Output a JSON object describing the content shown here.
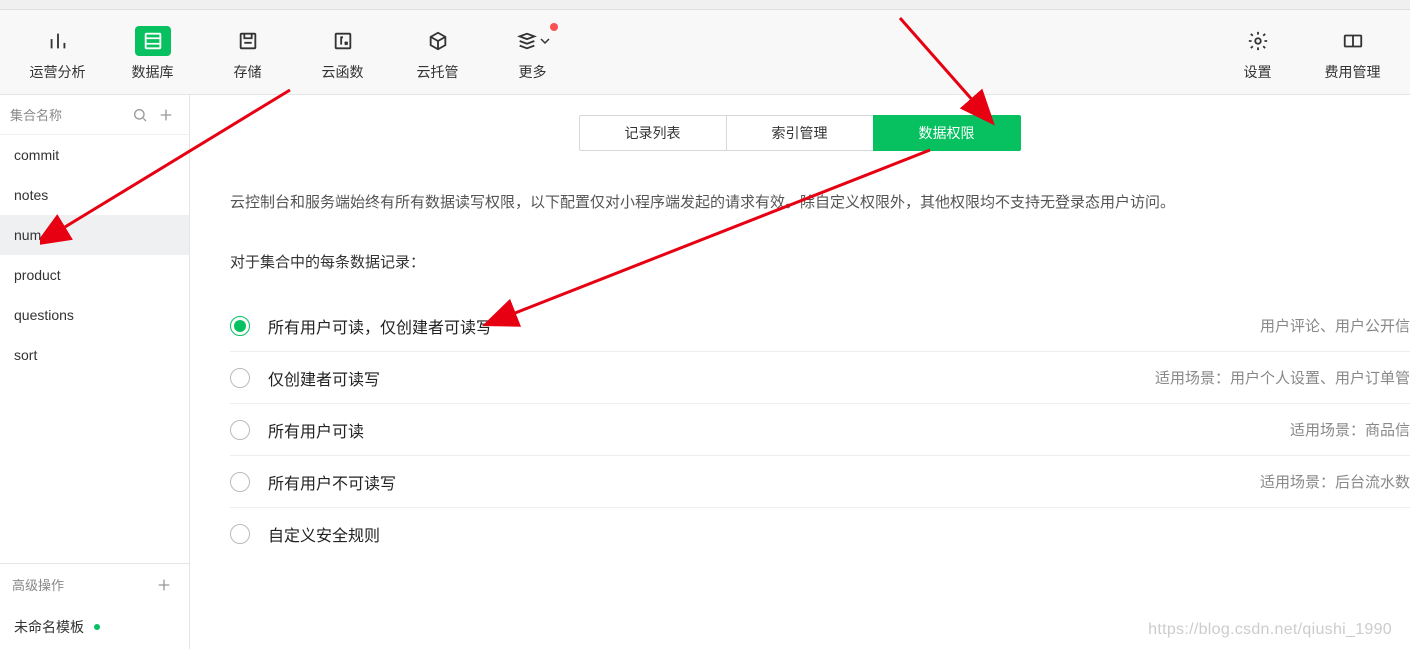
{
  "topnav": {
    "items": [
      {
        "label": "运营分析"
      },
      {
        "label": "数据库"
      },
      {
        "label": "存储"
      },
      {
        "label": "云函数"
      },
      {
        "label": "云托管"
      },
      {
        "label": "更多"
      }
    ],
    "right": [
      {
        "label": "设置"
      },
      {
        "label": "费用管理"
      }
    ]
  },
  "sidebar": {
    "header_label": "集合名称",
    "collections": [
      "commit",
      "notes",
      "num",
      "product",
      "questions",
      "sort"
    ],
    "selected": "num",
    "advanced_label": "高级操作",
    "template_label": "未命名模板"
  },
  "tabs": {
    "items": [
      "记录列表",
      "索引管理",
      "数据权限"
    ],
    "active": "数据权限"
  },
  "content": {
    "desc": "云控制台和服务端始终有所有数据读写权限，以下配置仅对小程序端发起的请求有效。除自定义权限外，其他权限均不支持无登录态用户访问。",
    "subhead": "对于集合中的每条数据记录：",
    "options": [
      {
        "label": "所有用户可读，仅创建者可读写",
        "hint": "用户评论、用户公开信",
        "checked": true
      },
      {
        "label": "仅创建者可读写",
        "hint": "适用场景：用户个人设置、用户订单管",
        "checked": false
      },
      {
        "label": "所有用户可读",
        "hint": "适用场景：商品信",
        "checked": false
      },
      {
        "label": "所有用户不可读写",
        "hint": "适用场景：后台流水数",
        "checked": false
      },
      {
        "label": "自定义安全规则",
        "hint": "",
        "checked": false
      }
    ]
  },
  "watermark": "https://blog.csdn.net/qiushi_1990"
}
